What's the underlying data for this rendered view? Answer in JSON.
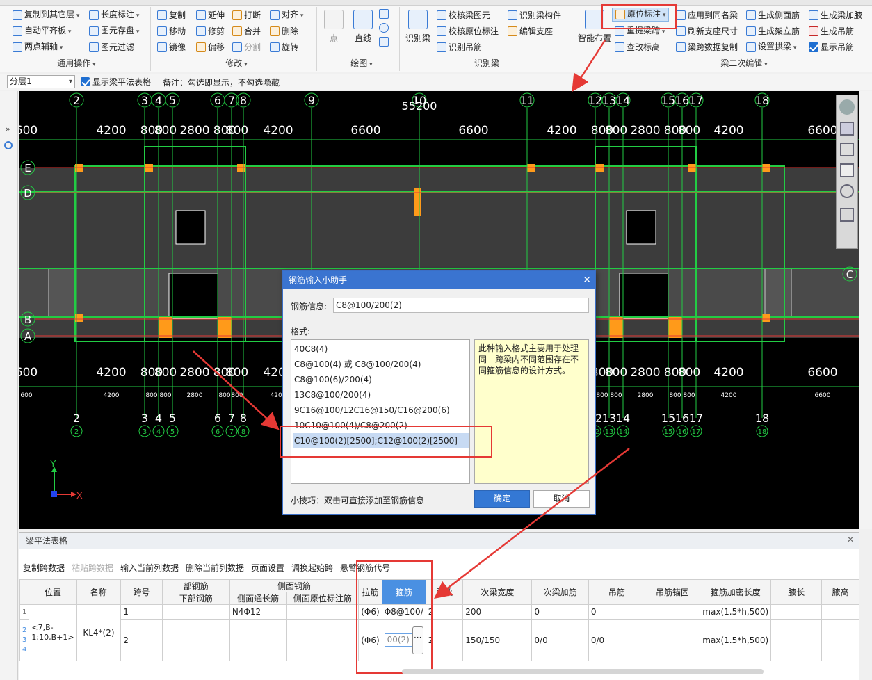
{
  "ribbon": {
    "top_text": "",
    "general": {
      "copy_to_floor": "复制到其它层",
      "auto_align": "自动平齐板",
      "two_point_axis": "两点辅轴",
      "length_label": "长度标注",
      "save_element": "图元存盘",
      "element_filter": "图元过滤",
      "group_label": "通用操作"
    },
    "modify": {
      "copy": "复制",
      "extend": "延伸",
      "break": "打断",
      "align": "对齐",
      "move": "移动",
      "trim": "修剪",
      "merge": "合并",
      "delete": "删除",
      "mirror": "镜像",
      "offset": "偏移",
      "split": "分割",
      "rotate": "旋转",
      "group_label": "修改"
    },
    "draw": {
      "point": "点",
      "line": "直线",
      "group_label": "绘图"
    },
    "identify_beam": {
      "identify_beam": "识别梁",
      "check_beam_element": "校核梁图元",
      "check_origin_label": "校核原位标注",
      "identify_hanger": "识别吊筋",
      "identify_beam_member": "识别梁构件",
      "edit_support": "编辑支座",
      "group_label": "识别梁"
    },
    "beam_edit": {
      "smart_layout": "智能布置",
      "origin_label": "原位标注",
      "redefine_span": "重提梁跨",
      "check_elevation": "查改标高",
      "apply_same_beam": "应用到同名梁",
      "refresh_support": "刷新支座尺寸",
      "span_data_copy": "梁跨数据复制",
      "gen_side_rebar": "生成侧面筋",
      "gen_stand_rebar": "生成架立筋",
      "set_arch_beam": "设置拱梁",
      "gen_haunch": "生成梁加腋",
      "gen_hanger": "生成吊筋",
      "show_hanger": "显示吊筋",
      "group_label": "梁二次编辑"
    }
  },
  "toolbar2": {
    "floor": "分层1",
    "show_table_label": "显示梁平法表格",
    "note": "备注：勾选即显示，不勾选隐藏"
  },
  "cad": {
    "total_dim": "55200",
    "top_axes": [
      "2",
      "3",
      "4",
      "5",
      "6",
      "7",
      "8",
      "9",
      "10",
      "11",
      "12",
      "13",
      "14",
      "15",
      "16",
      "17",
      "18"
    ],
    "bottom_axes": [
      "2",
      "3",
      "4",
      "5",
      "6",
      "7",
      "8",
      "9",
      "10",
      "11",
      "12",
      "13",
      "14",
      "15",
      "16",
      "17",
      "18"
    ],
    "row_axes": [
      "E",
      "D",
      "C",
      "B",
      "A"
    ],
    "dims_top": [
      "600",
      "4200",
      "800",
      "800",
      "2800",
      "800",
      "800",
      "4200",
      "6600",
      "6600",
      "4200",
      "800",
      "800",
      "2800",
      "800",
      "800",
      "4200",
      "6600"
    ],
    "dims_bottom": [
      "600",
      "4200",
      "800",
      "800",
      "2800",
      "800",
      "800",
      "4200",
      "6600",
      "6600",
      "4200",
      "800",
      "800",
      "2800",
      "800",
      "800",
      "4200",
      "6600"
    ],
    "dims_small": [
      "600",
      "4200",
      "800",
      "800",
      "2800",
      "800",
      "800",
      "4200",
      "6600",
      "6600",
      "4200",
      "800",
      "800",
      "2800",
      "800",
      "800",
      "4200",
      "6600"
    ],
    "axis_x_label": "X",
    "axis_y_label": "Y"
  },
  "dialog": {
    "title": "钢筋输入小助手",
    "info_label": "钢筋信息:",
    "info_value": "C8@100/200(2)",
    "format_label": "格式:",
    "formats": [
      "40C8(4)",
      "C8@100(4) 或 C8@100/200(4)",
      "C8@100(6)/200(4)",
      "13C8@100/200(4)",
      "9C16@100/12C16@150/C16@200(6)",
      "10C10@100(4)/C8@200(2)",
      "C10@100(2)[2500];C12@100(2)[2500]"
    ],
    "selected_index": 6,
    "description": "此种输入格式主要用于处理同一跨梁内不同范围存在不同箍筋信息的设计方式。",
    "tip": "小技巧：双击可直接添加至钢筋信息",
    "ok": "确定",
    "cancel": "取消"
  },
  "beam_table_panel": {
    "title": "梁平法表格",
    "tools": [
      "复制跨数据",
      "粘贴跨数据",
      "输入当前列数据",
      "删除当前列数据",
      "页面设置",
      "调换起始跨",
      "悬臂钢筋代号"
    ],
    "group_headers": {
      "rebar_group": "部钢筋",
      "side_group": "侧面钢筋"
    },
    "headers": [
      "位置",
      "名称",
      "跨号",
      "下部钢筋",
      "侧面通长筋",
      "侧面原位标注筋",
      "拉筋",
      "箍筋",
      "肢数",
      "次梁宽度",
      "次梁加筋",
      "吊筋",
      "吊筋锚固",
      "箍筋加密长度",
      "腋长",
      "腋高"
    ],
    "rows": [
      {
        "idx": "1",
        "position": "<7,B-1;10,B+1>",
        "name": "KL4*(2)",
        "span": "1",
        "bottom": "",
        "side_through": "N4Φ12",
        "side_origin": "",
        "tie": "(Φ6)",
        "stirrup": "Φ8@100/",
        "legs": "2",
        "sec_width": "200",
        "sec_add": "0",
        "hanger": "0",
        "hanger_anchor": "",
        "dense_len": "max(1.5*h,500)",
        "haunch_len": "",
        "haunch_h": ""
      },
      {
        "idx": "2",
        "position": "",
        "name": "",
        "span": "2",
        "bottom": "",
        "side_through": "",
        "side_origin": "",
        "tie": "(Φ6)",
        "stirrup": "00(2)",
        "legs": "2",
        "sec_width": "150/150",
        "sec_add": "0/0",
        "hanger": "0/0",
        "hanger_anchor": "",
        "dense_len": "max(1.5*h,500)",
        "haunch_len": "",
        "haunch_h": ""
      }
    ],
    "row_nums": [
      "1",
      "2",
      "3",
      "4"
    ],
    "more_btn": "···"
  }
}
